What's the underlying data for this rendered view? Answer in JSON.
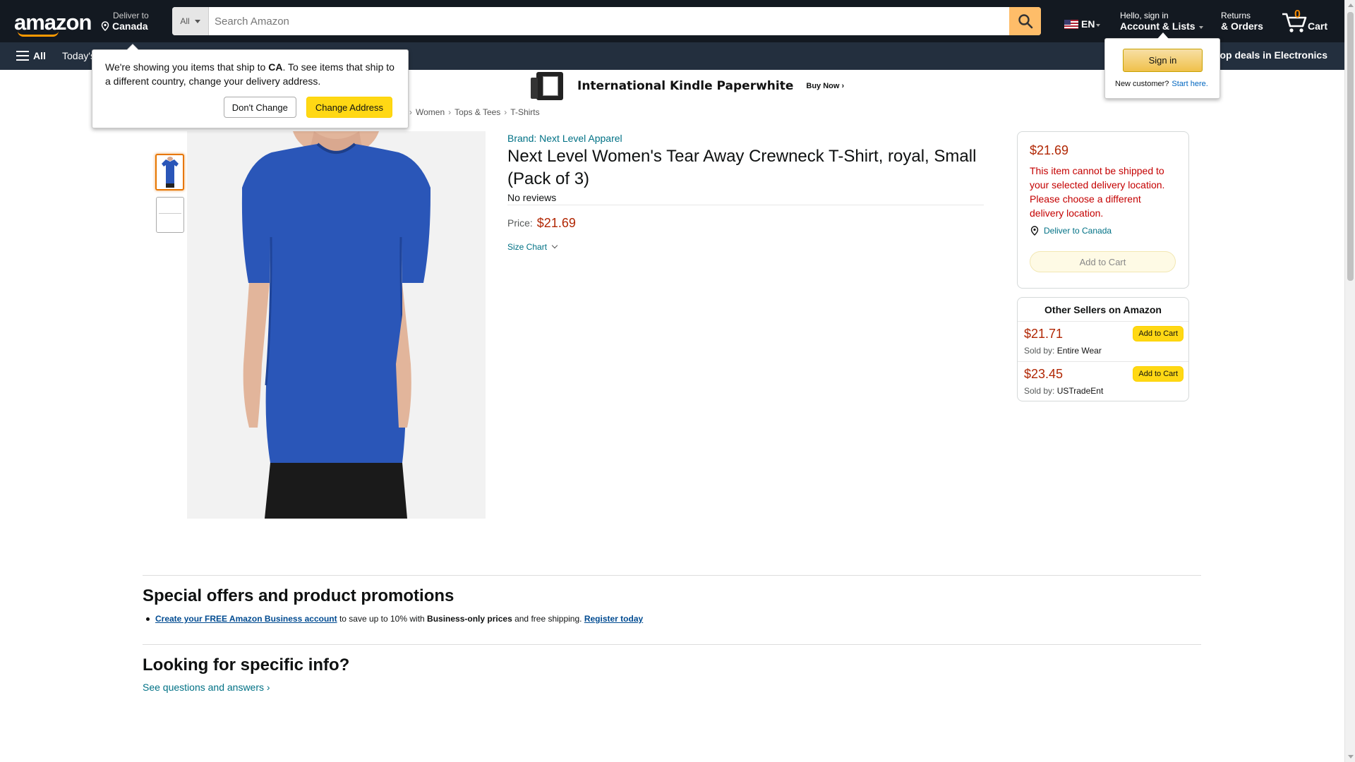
{
  "header": {
    "logo": "amazon",
    "deliver_small": "Deliver to",
    "deliver_big": "Canada",
    "search_category": "All",
    "search_placeholder": "Search Amazon",
    "lang": "EN",
    "account_small": "Hello, sign in",
    "account_big": "Account & Lists",
    "returns_small": "Returns",
    "returns_big": "& Orders",
    "cart_count": "0",
    "cart_label": "Cart"
  },
  "subnav": {
    "all": "All",
    "today": "Today's Deals",
    "electronics": "Shop deals in Electronics"
  },
  "banner": {
    "title": "International Kindle Paperwhite",
    "cta": "Buy Now ›"
  },
  "popover": {
    "msg_pre": "We're showing you items that ship to ",
    "msg_country": "CA",
    "msg_post": ". To see items that ship to a different country, change your delivery address.",
    "dont_change": "Don't Change",
    "change_address": "Change Address"
  },
  "signin": {
    "button": "Sign in",
    "new_customer": "New customer?",
    "start_here": "Start here."
  },
  "breadcrumb": [
    "Women",
    "Tops & Tees",
    "T-Shirts"
  ],
  "product": {
    "brand": "Brand: Next Level Apparel",
    "title": "Next Level Women's Tear Away Crewneck T-Shirt, royal, Small (Pack of 3)",
    "reviews": "No reviews",
    "price_label": "Price:",
    "price": "$21.69",
    "size_chart": "Size Chart"
  },
  "buybox": {
    "price": "$21.69",
    "warning": "This item cannot be shipped to your selected delivery location. Please choose a different delivery location.",
    "deliver": "Deliver to Canada",
    "add_to_cart": "Add to Cart"
  },
  "sellers": {
    "header": "Other Sellers on Amazon",
    "sold_by_label": "Sold by:",
    "button": "Add to Cart",
    "rows": [
      {
        "price": "$21.71",
        "seller": "Entire Wear"
      },
      {
        "price": "$23.45",
        "seller": "USTradeEnt"
      }
    ]
  },
  "offers": {
    "heading": "Special offers and product promotions",
    "link1": "Create your FREE Amazon Business account",
    "text1": " to save up to 10% with ",
    "bold": "Business-only prices",
    "text2": " and free shipping. ",
    "link2": "Register today"
  },
  "info": {
    "heading": "Looking for specific info?",
    "qa": "See questions and answers ›"
  },
  "colors": {
    "nav_dark": "#131921",
    "nav_secondary": "#232f3e",
    "accent": "#ff9900",
    "price_red": "#b12704",
    "link_teal": "#007185",
    "button_yellow": "#ffd814",
    "shirt_royal": "#2a56b8"
  }
}
